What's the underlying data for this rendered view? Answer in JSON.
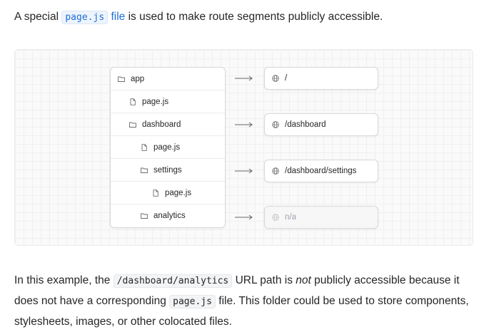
{
  "intro": {
    "prefix": "A special ",
    "link_code": "page.js",
    "link_suffix": " file",
    "suffix": " is used to make route segments publicly accessible."
  },
  "tree": {
    "rows": [
      {
        "label": "app",
        "icon": "folder-icon"
      },
      {
        "label": "page.js",
        "icon": "file-icon"
      },
      {
        "label": "dashboard",
        "icon": "folder-icon"
      },
      {
        "label": "page.js",
        "icon": "file-icon"
      },
      {
        "label": "settings",
        "icon": "folder-icon"
      },
      {
        "label": "page.js",
        "icon": "file-icon"
      },
      {
        "label": "analytics",
        "icon": "folder-icon"
      }
    ]
  },
  "routes": [
    {
      "path": "/",
      "icon": "globe-icon"
    },
    {
      "path": "/dashboard",
      "icon": "globe-icon"
    },
    {
      "path": "/dashboard/settings",
      "icon": "globe-icon"
    },
    {
      "path": "n/a",
      "icon": "globe-icon",
      "muted": true
    }
  ],
  "outro": {
    "part1": "In this example, the ",
    "code1": "/dashboard/analytics",
    "part2": " URL path is ",
    "em": "not",
    "part3": " publicly accessible because it does not have a corresponding ",
    "code2": "page.js",
    "part4": " file. This folder could be used to store components, stylesheets, images, or other colocated files."
  },
  "colors": {
    "link": "#1d6fd6",
    "text": "#262626",
    "muted": "#9ca3af"
  }
}
